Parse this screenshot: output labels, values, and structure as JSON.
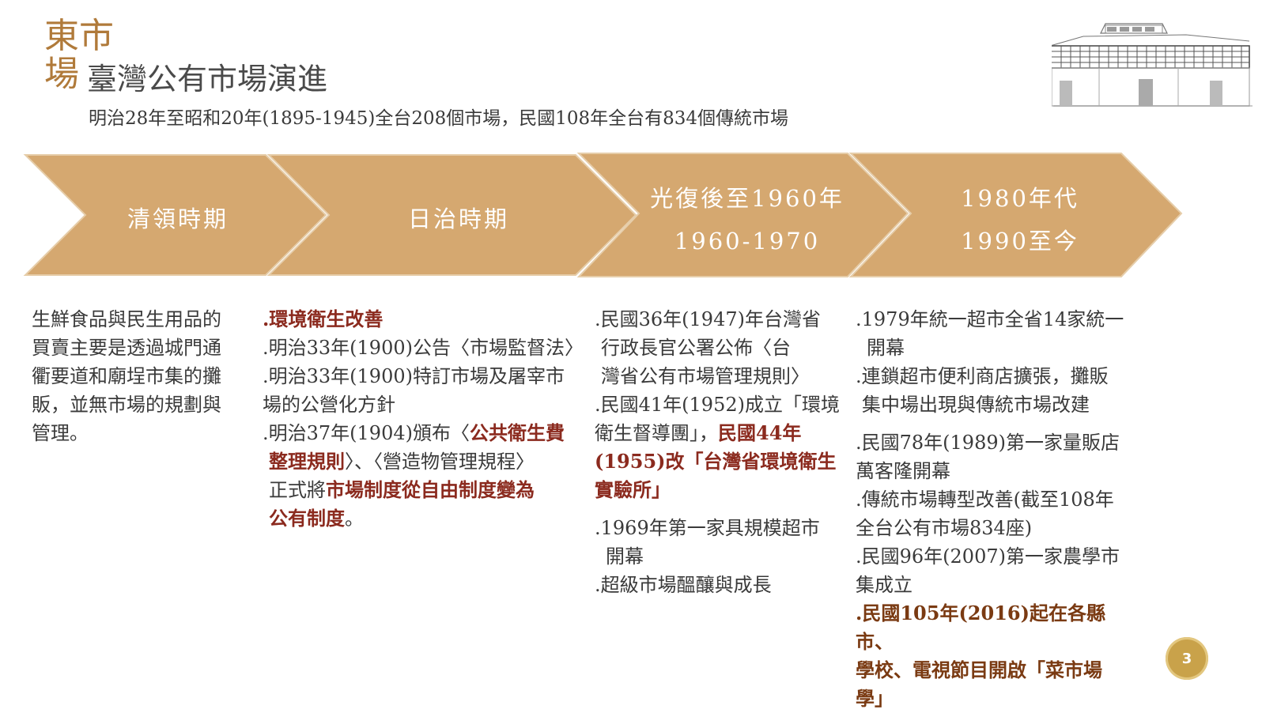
{
  "header": {
    "brand_line1": "東市",
    "brand_line2": "場",
    "title": "臺灣公有市場演進",
    "subtitle": "明治28年至昭和20年(1895-1945)全台208個市場，民國108年全台有834個傳統市場"
  },
  "colors": {
    "accent": "#d5a870",
    "brand": "#b07a3a",
    "highlight": "#8b2a1e"
  },
  "timeline": [
    {
      "lines": [
        "清領時期"
      ]
    },
    {
      "lines": [
        "日治時期"
      ]
    },
    {
      "lines": [
        "光復後至1960年",
        "1960-1970"
      ]
    },
    {
      "lines": [
        "1980年代",
        "1990至今"
      ]
    }
  ],
  "columns": {
    "c1": [
      "生鮮食品與民生用品的",
      "買賣主要是透過城門通",
      "衢要道和廟埕市集的攤",
      "販，並無市場的規劃與",
      "管理。"
    ],
    "c2": {
      "l1": ".環境衛生改善",
      "l2": ".明治33年(1900)公告〈市場監督法〉",
      "l3": ".明治33年(1900)特訂市場及屠宰市",
      "l4": "場的公營化方針",
      "l5a": ".明治37年(1904)頒布〈",
      "l5b": "公共衛生費",
      "l6a": "整理規則",
      "l6b": "〉、〈營造物管理規程〉",
      "l7a": "正式將",
      "l7b": "市場制度從自由制度變為",
      "l8a": "公有制度",
      "l8b": "。"
    },
    "c3": {
      "l1": ".民國36年(1947)年台灣省",
      "l2": "行政長官公署公佈〈台",
      "l3": "灣省公有市場管理規則〉",
      "l4": ".民國41年(1952)成立「環境",
      "l5a": "衛生督導團」，",
      "l5b": "民國44年",
      "l6": "(1955)改「台灣省環境衛生",
      "l7": "實驗所」",
      "l8": ".1969年第一家具規模超市",
      "l9": "開幕",
      "l10": ".超級市場醞釀與成長"
    },
    "c4": {
      "l1": ".1979年統一超市全省14家統一",
      "l2": "開幕",
      "l3": ".連鎖超市便利商店擴張，攤販",
      "l4": "集中場出現與傳統市場改建",
      "l5": ".民國78年(1989)第一家量販店",
      "l6": "萬客隆開幕",
      "l7": ".傳統市場轉型改善(截至108年",
      "l8": "全台公有市場834座)",
      "l9": ".民國96年(2007)第一家農學市",
      "l10": "集成立",
      "l11": ".民國105年(2016)起在各縣市、",
      "l12": "學校、電視節目開啟「菜市場",
      "l13": "學」"
    }
  },
  "page_number": "3"
}
